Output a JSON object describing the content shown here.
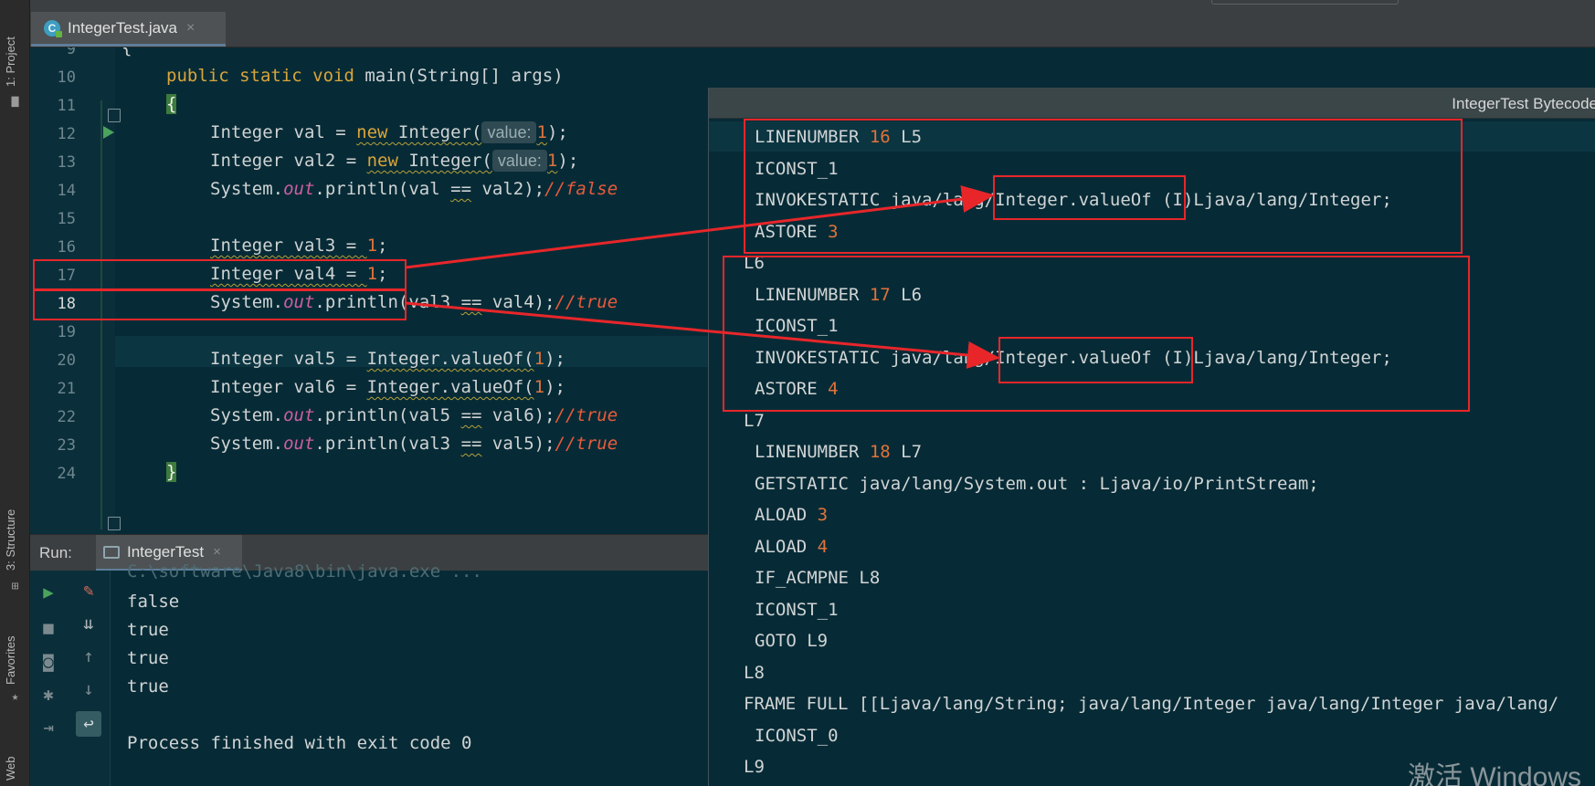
{
  "colors": {
    "editor_bg": "#072b36",
    "keyword": "#d9a53b",
    "number": "#e0733b",
    "comment": "#e85b3c",
    "field": "#cd5fa0",
    "annotation_red": "#e8262a"
  },
  "tool_windows": {
    "project": "1: Project",
    "structure": "3: Structure",
    "favorites": "Favorites",
    "web": "Web"
  },
  "editor": {
    "tab_label": "IntegerTest.java",
    "tab_close": "×",
    "line_numbers": [
      "9",
      "10",
      "11",
      "12",
      "13",
      "14",
      "15",
      "16",
      "17",
      "18",
      "19",
      "20",
      "21",
      "22",
      "23",
      "24"
    ],
    "param_hint": "value:",
    "code": {
      "l9": "{",
      "l10_kw": "public static void",
      "l10_rest": " main(String[] args)",
      "l11": "{",
      "l12_pre": "Integer val = ",
      "l12_new": "new",
      "l12_cls": " Integer(",
      "l12_num": "1",
      "l12_end": ");",
      "l13_pre": "Integer val2 = ",
      "l13_new": "new",
      "l13_cls": " Integer(",
      "l13_num": "1",
      "l13_end": ");",
      "l14_pre": "System.",
      "l14_out": "out",
      "l14_mid": ".println(val ",
      "l14_eq": "==",
      "l14_end": " val2);",
      "l14_cmt": "//false",
      "l16_pre": "Integer val3 = ",
      "l16_num": "1",
      "l16_end": ";",
      "l17_pre": "Integer val4 = ",
      "l17_num": "1",
      "l17_end": ";",
      "l18_pre": "System.",
      "l18_out": "out",
      "l18_mid": ".println(val3 ",
      "l18_eq": "==",
      "l18_end": " val4);",
      "l18_cmt": "//true",
      "l20_pre": "Integer val5 = ",
      "l20_call": "Integer.valueOf(",
      "l20_num": "1",
      "l20_end": ");",
      "l21_pre": "Integer val6 = ",
      "l21_call": "Integer.valueOf(",
      "l21_num": "1",
      "l21_end": ");",
      "l22_pre": "System.",
      "l22_out": "out",
      "l22_mid": ".println(val5 ",
      "l22_eq": "==",
      "l22_end": " val6);",
      "l22_cmt": "//true",
      "l23_pre": "System.",
      "l23_out": "out",
      "l23_mid": ".println(val3 ",
      "l23_eq": "==",
      "l23_end": " val5);",
      "l23_cmt": "//true",
      "l24": "}"
    }
  },
  "run": {
    "label": "Run:",
    "tab_label": "IntegerTest",
    "tab_close": "×",
    "command_line": "C:\\software\\Java8\\bin\\java.exe ...",
    "output": [
      "false",
      "true",
      "true",
      "true"
    ],
    "exit_message": "Process finished with exit code 0"
  },
  "bytecode": {
    "title": "IntegerTest Bytecode",
    "lines": [
      {
        "indent": true,
        "text": "LINENUMBER ",
        "num": "16",
        "tail": " L5"
      },
      {
        "indent": true,
        "text": "ICONST_1",
        "num": "",
        "tail": ""
      },
      {
        "indent": true,
        "text": "INVOKESTATIC java/lang/Integer.valueOf (I)Ljava/lang/Integer;",
        "num": "",
        "tail": ""
      },
      {
        "indent": true,
        "text": "ASTORE ",
        "num": "3",
        "tail": ""
      },
      {
        "indent": false,
        "text": "L6",
        "num": "",
        "tail": ""
      },
      {
        "indent": true,
        "text": "LINENUMBER ",
        "num": "17",
        "tail": " L6"
      },
      {
        "indent": true,
        "text": "ICONST_1",
        "num": "",
        "tail": ""
      },
      {
        "indent": true,
        "text": "INVOKESTATIC java/lang/Integer.valueOf (I)Ljava/lang/Integer;",
        "num": "",
        "tail": ""
      },
      {
        "indent": true,
        "text": "ASTORE ",
        "num": "4",
        "tail": ""
      },
      {
        "indent": false,
        "text": "L7",
        "num": "",
        "tail": ""
      },
      {
        "indent": true,
        "text": "LINENUMBER ",
        "num": "18",
        "tail": " L7"
      },
      {
        "indent": true,
        "text": "GETSTATIC java/lang/System.out : Ljava/io/PrintStream;",
        "num": "",
        "tail": ""
      },
      {
        "indent": true,
        "text": "ALOAD ",
        "num": "3",
        "tail": ""
      },
      {
        "indent": true,
        "text": "ALOAD ",
        "num": "4",
        "tail": ""
      },
      {
        "indent": true,
        "text": "IF_ACMPNE L8",
        "num": "",
        "tail": ""
      },
      {
        "indent": true,
        "text": "ICONST_1",
        "num": "",
        "tail": ""
      },
      {
        "indent": true,
        "text": "GOTO L9",
        "num": "",
        "tail": ""
      },
      {
        "indent": false,
        "text": "L8",
        "num": "",
        "tail": ""
      },
      {
        "indent": false,
        "text": "FRAME FULL [[Ljava/lang/String; java/lang/Integer java/lang/Integer java/lang/",
        "num": "",
        "tail": ""
      },
      {
        "indent": true,
        "text": "ICONST_0",
        "num": "",
        "tail": ""
      },
      {
        "indent": false,
        "text": "L9",
        "num": "",
        "tail": ""
      }
    ]
  },
  "watermark": "激活 Windows"
}
